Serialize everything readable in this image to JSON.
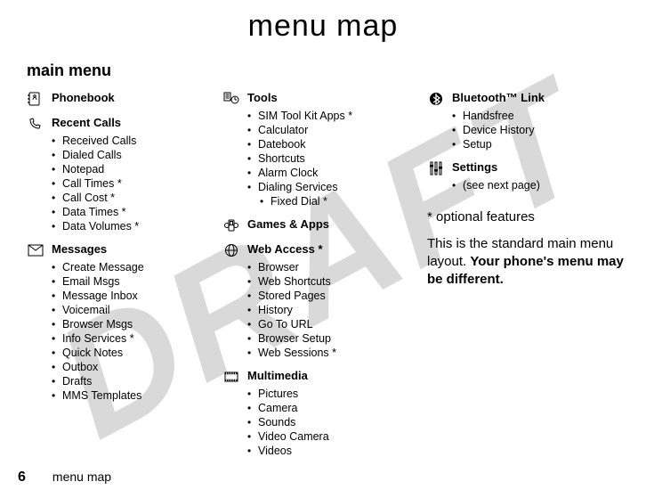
{
  "watermark": "DRAFT",
  "title": "menu map",
  "subtitle": "main menu",
  "footer": {
    "page": "6",
    "text": "menu map"
  },
  "note_opt": "* optional features",
  "note_line1": "This is the standard main menu layout. ",
  "note_line2": "Your phone's menu may be different.",
  "sections": {
    "phonebook": {
      "label": "Phonebook"
    },
    "recent": {
      "label": "Recent Calls",
      "items": [
        "Received Calls",
        "Dialed Calls",
        "Notepad",
        "Call Times *",
        "Call Cost *",
        "Data Times *",
        "Data Volumes *"
      ]
    },
    "messages": {
      "label": "Messages",
      "items": [
        "Create Message",
        "Email Msgs",
        "Message Inbox",
        "Voicemail",
        "Browser Msgs",
        "Info Services *",
        "Quick Notes",
        "Outbox",
        "Drafts",
        "MMS Templates"
      ]
    },
    "tools": {
      "label": "Tools",
      "items": [
        "SIM Tool Kit Apps *",
        "Calculator",
        "Datebook",
        "Shortcuts",
        "Alarm Clock",
        "Dialing Services"
      ],
      "sub": [
        "Fixed Dial *"
      ]
    },
    "games": {
      "label": "Games & Apps"
    },
    "web": {
      "label": "Web Access *",
      "items": [
        "Browser",
        "Web Shortcuts",
        "Stored Pages",
        "History",
        "Go To URL",
        "Browser Setup",
        "Web Sessions *"
      ]
    },
    "mm": {
      "label": "Multimedia",
      "items": [
        "Pictures",
        "Camera",
        "Sounds",
        "Video Camera",
        "Videos"
      ]
    },
    "bt": {
      "label": "Bluetooth™ Link",
      "items": [
        "Handsfree",
        "Device History",
        "Setup"
      ]
    },
    "settings": {
      "label": "Settings",
      "items": [
        "(see next page)"
      ]
    }
  }
}
